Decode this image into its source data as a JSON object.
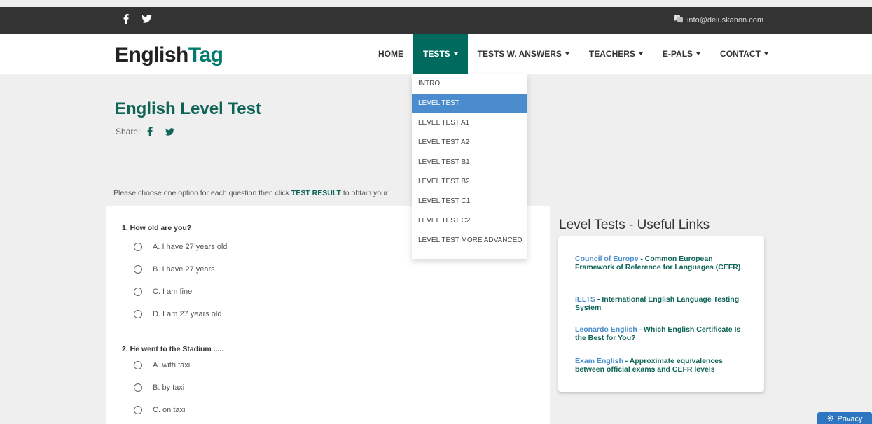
{
  "topbar": {
    "email": "info@deluskanon.com",
    "social_icons": [
      "facebook-icon",
      "twitter-icon"
    ],
    "background": "#333333"
  },
  "brand": {
    "part1": "English",
    "part2": "Tag",
    "accent": "#007a6c"
  },
  "nav": {
    "items": [
      {
        "label": "HOME",
        "has_caret": false,
        "active": false
      },
      {
        "label": "TESTS",
        "has_caret": true,
        "active": true
      },
      {
        "label": "TESTS W. ANSWERS",
        "has_caret": true,
        "active": false
      },
      {
        "label": "TEACHERS",
        "has_caret": true,
        "active": false
      },
      {
        "label": "E-PALS",
        "has_caret": true,
        "active": false
      },
      {
        "label": "CONTACT",
        "has_caret": true,
        "active": false
      }
    ],
    "active_color": "#006a5f"
  },
  "dropdown": {
    "items": [
      "INTRO",
      "LEVEL TEST",
      "LEVEL TEST A1",
      "LEVEL TEST A2",
      "LEVEL TEST B1",
      "LEVEL TEST B2",
      "LEVEL TEST C1",
      "LEVEL TEST C2",
      "LEVEL TEST MORE ADVANCED"
    ],
    "active_index": 1,
    "highlight_color": "#4a8ccd"
  },
  "page": {
    "title": "English Level Test",
    "share_label": "Share:",
    "instructions_pre": "Please choose one option for each question then click ",
    "instructions_bold": "TEST RESULT",
    "instructions_post": " to obtain your"
  },
  "questions": [
    {
      "text": "1. How old are you?",
      "options": [
        "A. I have 27 years old",
        "B. I have 27 years",
        "C. I am fine",
        "D. I am 27 years old"
      ]
    },
    {
      "text": "2. He went to the Stadium .....",
      "options": [
        "A. with taxi",
        "B. by taxi",
        "C. on taxi"
      ]
    }
  ],
  "sidebar": {
    "heading": "Level Tests - Useful Links",
    "links": [
      {
        "source": "Council of Europe",
        "text": " - Common European Framework of Reference for Languages (CEFR)"
      },
      {
        "source": "IELTS",
        "text": " - International English Language Testing System"
      },
      {
        "source": "Leonardo English",
        "text": " - Which English Certificate Is the Best for You?"
      },
      {
        "source": "Exam English",
        "text": " - Approximate equivalences between official exams and CEFR levels"
      }
    ]
  },
  "privacy": {
    "label": "Privacy",
    "icon": "gear-icon"
  }
}
